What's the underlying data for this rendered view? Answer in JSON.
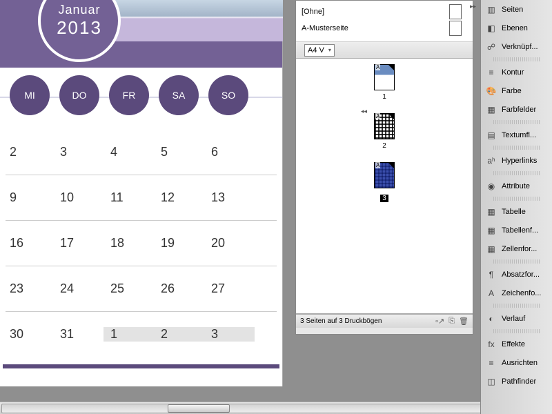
{
  "calendar": {
    "month": "Januar",
    "year": "2013",
    "days": [
      "MI",
      "DO",
      "FR",
      "SA",
      "SO"
    ],
    "rows": [
      [
        "2",
        "3",
        "4",
        "5",
        "6"
      ],
      [
        "9",
        "10",
        "11",
        "12",
        "13"
      ],
      [
        "16",
        "17",
        "18",
        "19",
        "20"
      ],
      [
        "23",
        "24",
        "25",
        "26",
        "27"
      ],
      [
        "30",
        "31",
        "1",
        "2",
        "3"
      ]
    ]
  },
  "pagesPanel": {
    "masters": [
      "[Ohne]",
      "A-Musterseite"
    ],
    "pageSize": "A4 V",
    "pages": [
      "1",
      "2",
      "3"
    ],
    "status": "3 Seiten auf 3 Druckbögen"
  },
  "dock": {
    "groups": [
      [
        "Seiten",
        "Ebenen",
        "Verknüpf..."
      ],
      [
        "Kontur",
        "Farbe",
        "Farbfelder"
      ],
      [
        "Textumfl..."
      ],
      [
        "Hyperlinks"
      ],
      [
        "Attribute"
      ],
      [
        "Tabelle",
        "Tabellenf...",
        "Zellenfor..."
      ],
      [
        "Absatzfor...",
        "Zeichenfo..."
      ],
      [
        "Verlauf"
      ],
      [
        "Effekte",
        "Ausrichten",
        "Pathfinder"
      ]
    ],
    "icons": {
      "Seiten": "▥",
      "Ebenen": "◧",
      "Verknüpf...": "☍",
      "Kontur": "≡",
      "Farbe": "🎨",
      "Farbfelder": "▦",
      "Textumfl...": "▤",
      "Hyperlinks": "aʰ",
      "Attribute": "◉",
      "Tabelle": "▦",
      "Tabellenf...": "▦",
      "Zellenfor...": "▦",
      "Absatzfor...": "¶",
      "Zeichenfo...": "A",
      "Verlauf": "◐",
      "Effekte": "fx",
      "Ausrichten": "≡",
      "Pathfinder": "◫"
    }
  }
}
